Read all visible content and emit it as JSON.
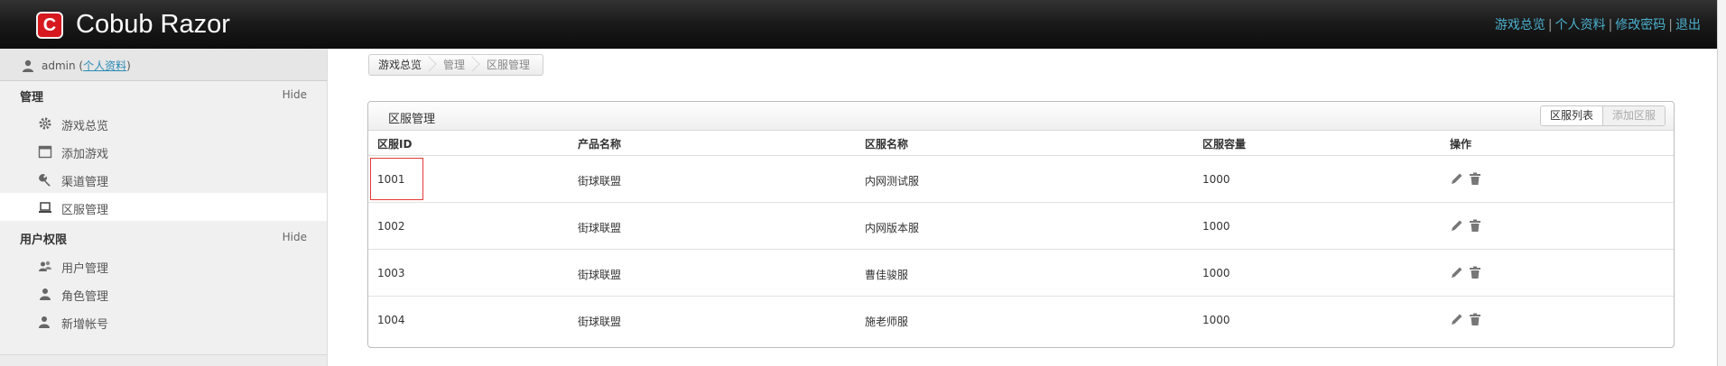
{
  "header": {
    "logo_letter": "C",
    "brand": "Cobub Razor",
    "links": [
      "游戏总览",
      "个人资料",
      "修改密码",
      "退出"
    ],
    "separator": "|"
  },
  "sidebar": {
    "user": {
      "name": "admin",
      "profile_link": "个人资料"
    },
    "groups": [
      {
        "title": "管理",
        "toggle": "Hide",
        "items": [
          {
            "label": "游戏总览",
            "icon": "gear-icon"
          },
          {
            "label": "添加游戏",
            "icon": "calendar-icon"
          },
          {
            "label": "渠道管理",
            "icon": "wrench-icon"
          },
          {
            "label": "区服管理",
            "icon": "laptop-icon",
            "active": true
          }
        ]
      },
      {
        "title": "用户权限",
        "toggle": "Hide",
        "items": [
          {
            "label": "用户管理",
            "icon": "users-icon"
          },
          {
            "label": "角色管理",
            "icon": "user-role-icon"
          },
          {
            "label": "新增帐号",
            "icon": "user-add-icon"
          }
        ]
      }
    ]
  },
  "breadcrumb": [
    "游戏总览",
    "管理",
    "区服管理"
  ],
  "panel": {
    "title": "区服管理",
    "tabs": [
      {
        "label": "区服列表",
        "active": true
      },
      {
        "label": "添加区服",
        "active": false
      }
    ],
    "columns": [
      "区服ID",
      "产品名称",
      "区服名称",
      "区服容量",
      "操作"
    ],
    "rows": [
      {
        "id": "1001",
        "product": "街球联盟",
        "server": "内网测试服",
        "capacity": "1000"
      },
      {
        "id": "1002",
        "product": "街球联盟",
        "server": "内网版本服",
        "capacity": "1000"
      },
      {
        "id": "1003",
        "product": "街球联盟",
        "server": "曹佳骏服",
        "capacity": "1000"
      },
      {
        "id": "1004",
        "product": "街球联盟",
        "server": "施老师服",
        "capacity": "1000"
      }
    ],
    "row_actions": [
      "edit-icon",
      "trash-icon"
    ]
  },
  "colors": {
    "topbar": "#111111",
    "link": "#4bb1cf",
    "highlight": "#e53935",
    "logo": "#d6191f"
  }
}
